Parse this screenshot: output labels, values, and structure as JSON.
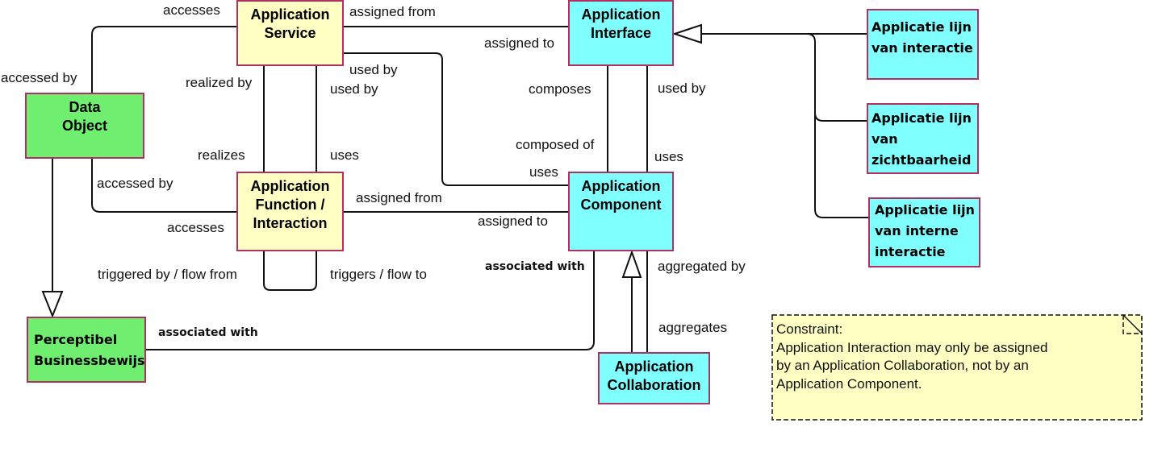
{
  "nodes": {
    "app_service": "Application Service",
    "app_interface": "Application Interface",
    "data_object": "Data Object",
    "app_function": "Application Function / Interaction",
    "app_component": "Application Component",
    "lijn_interactie": "Applicatie lijn van interactie",
    "lijn_zichtbaarheid": "Applicatie lijn van zichtbaarheid",
    "lijn_interne": "Applicatie lijn van interne interactie",
    "perceptibel": "Perceptibel Businessbewijs",
    "app_collaboration": "Application Collaboration"
  },
  "labels": {
    "accesses_top": "accesses",
    "assigned_from_top": "assigned from",
    "assigned_to_top": "assigned to",
    "accessed_by_left": "accessed by",
    "realized_by": "realized by",
    "used_by_1": "used by",
    "used_by_2": "used by",
    "composes": "composes",
    "used_by_3": "used by",
    "realizes": "realizes",
    "uses_1": "uses",
    "composed_of": "composed of",
    "uses_2": "uses",
    "uses_3": "uses",
    "accessed_by_2": "accessed by",
    "assigned_from_2": "assigned from",
    "accesses_2": "accesses",
    "assigned_to_2": "assigned to",
    "associated_with_1": "associated with",
    "aggregated_by": "aggregated by",
    "triggered_by": "triggered by / flow from",
    "triggers": "triggers / flow to",
    "associated_with_2": "associated with",
    "aggregates": "aggregates"
  },
  "note": {
    "title": "Constraint:",
    "line1": "Application Interaction may only be assigned",
    "line2": "by  an Application Collaboration, not by an",
    "line3": "Application  Component."
  },
  "colors": {
    "service": "#ffffc4",
    "interface": "#80ffff",
    "data": "#70ee70",
    "border": "#b03060"
  }
}
